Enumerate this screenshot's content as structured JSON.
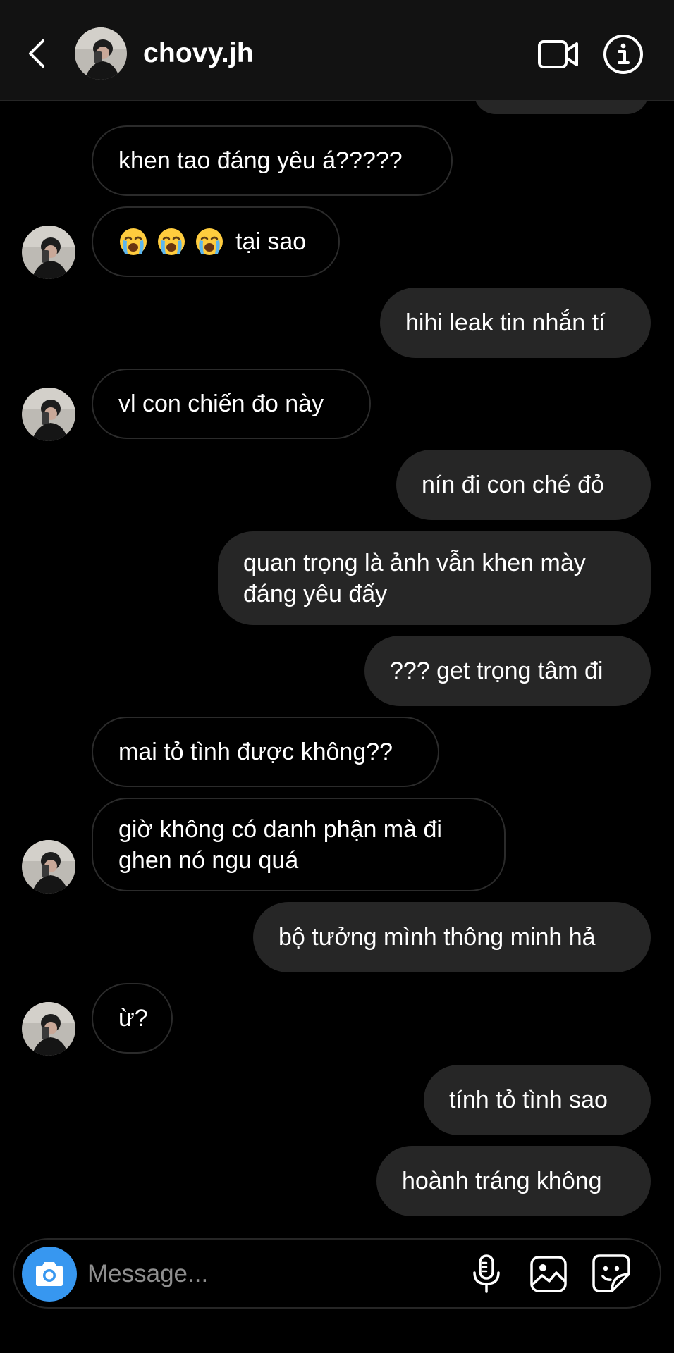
{
  "header": {
    "username": "chovy.jh",
    "back_icon": "chevron-left-icon",
    "video_icon": "video-camera-icon",
    "info_icon": "info-icon"
  },
  "messages": [
    {
      "from": "them",
      "text": "khen tao đáng yêu á?????"
    },
    {
      "from": "them",
      "emojis": [
        "loudly-crying-face",
        "loudly-crying-face",
        "loudly-crying-face"
      ],
      "text": "tại sao"
    },
    {
      "from": "me",
      "text": "hihi leak tin nhắn tí"
    },
    {
      "from": "them",
      "text": "vl con chiến đo này"
    },
    {
      "from": "me",
      "text": "nín đi con ché đỏ"
    },
    {
      "from": "me",
      "text": "quan trọng là ảnh vẫn khen mày đáng yêu đấy"
    },
    {
      "from": "me",
      "text": "??? get trọng tâm đi"
    },
    {
      "from": "them",
      "text": "mai tỏ tình được không??"
    },
    {
      "from": "them",
      "text": "giờ không có danh phận mà đi ghen nó ngu quá"
    },
    {
      "from": "me",
      "text": "bộ tưởng mình thông minh hả"
    },
    {
      "from": "them",
      "text": "ừ?"
    },
    {
      "from": "me",
      "text": "tính tỏ tình sao"
    },
    {
      "from": "me",
      "text": "hoành tráng không"
    }
  ],
  "composer": {
    "placeholder": "Message...",
    "value": "",
    "camera_icon": "camera-icon",
    "mic_icon": "microphone-icon",
    "gallery_icon": "image-gallery-icon",
    "sticker_icon": "sticker-icon",
    "accent_color": "#3797f0"
  },
  "colors": {
    "background": "#000000",
    "header_bg": "#121212",
    "outgoing_bubble": "#262626",
    "incoming_border": "#2b2b2b",
    "placeholder": "#8e8e8e"
  }
}
